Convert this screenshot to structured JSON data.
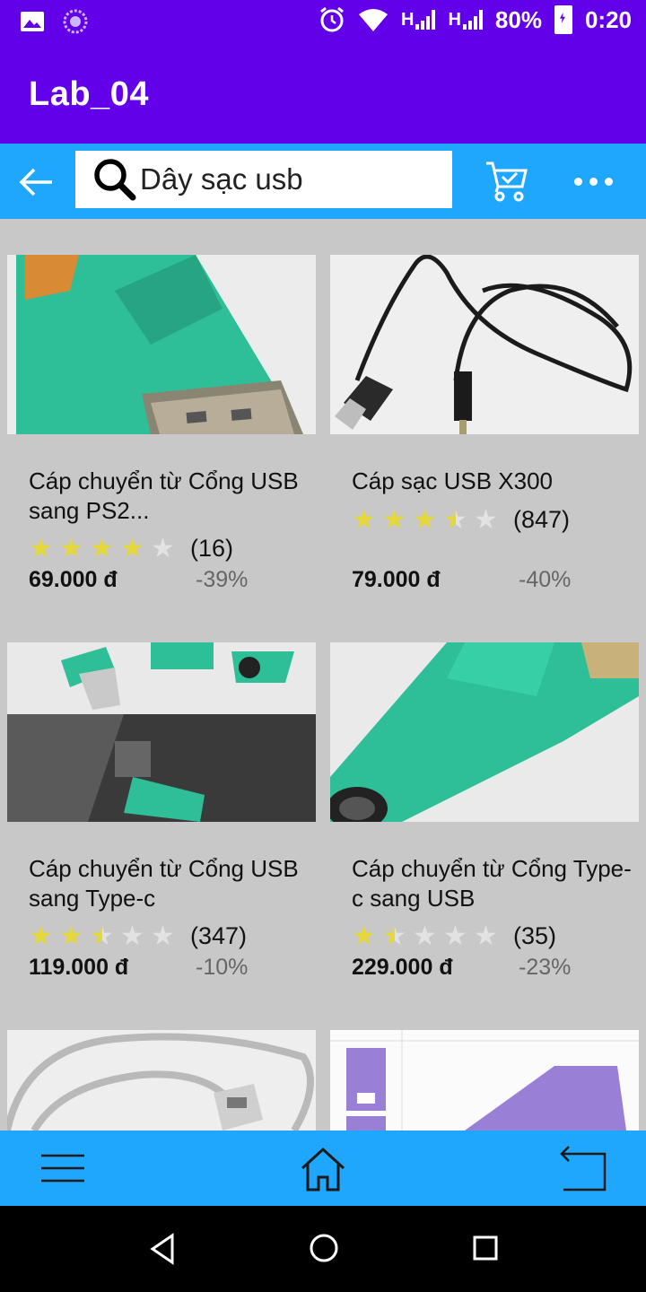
{
  "status_bar": {
    "network_1": "H",
    "network_2": "H",
    "battery": "80%",
    "time": "0:20"
  },
  "app_bar": {
    "title": "Lab_04"
  },
  "search": {
    "query": "Dây sạc usb"
  },
  "products": [
    {
      "name": "Cáp chuyển từ Cổng USB sang PS2...",
      "rating": 4,
      "reviews": "(16)",
      "price": "69.000 đ",
      "discount": "-39%"
    },
    {
      "name": "Cáp sạc USB X300",
      "rating": 3.5,
      "reviews": "(847)",
      "price": "79.000 đ",
      "discount": "-40%"
    },
    {
      "name": "Cáp chuyển từ Cổng USB sang Type-c",
      "rating": 2.5,
      "reviews": "(347)",
      "price": "119.000 đ",
      "discount": "-10%"
    },
    {
      "name": "Cáp chuyển từ Cổng Type-c sang USB",
      "rating": 1.5,
      "reviews": "(35)",
      "price": "229.000 đ",
      "discount": "-23%"
    }
  ],
  "colors": {
    "app_bar": "#6200ea",
    "toolbar": "#1ea7fd",
    "background": "#c8c8c8",
    "star": "#e4d83a"
  },
  "icons": [
    "image-icon",
    "loading-icon",
    "alarm-icon",
    "wifi-icon",
    "battery-icon",
    "back-arrow-icon",
    "search-icon",
    "cart-icon",
    "more-icon",
    "menu-icon",
    "home-icon",
    "return-icon"
  ]
}
